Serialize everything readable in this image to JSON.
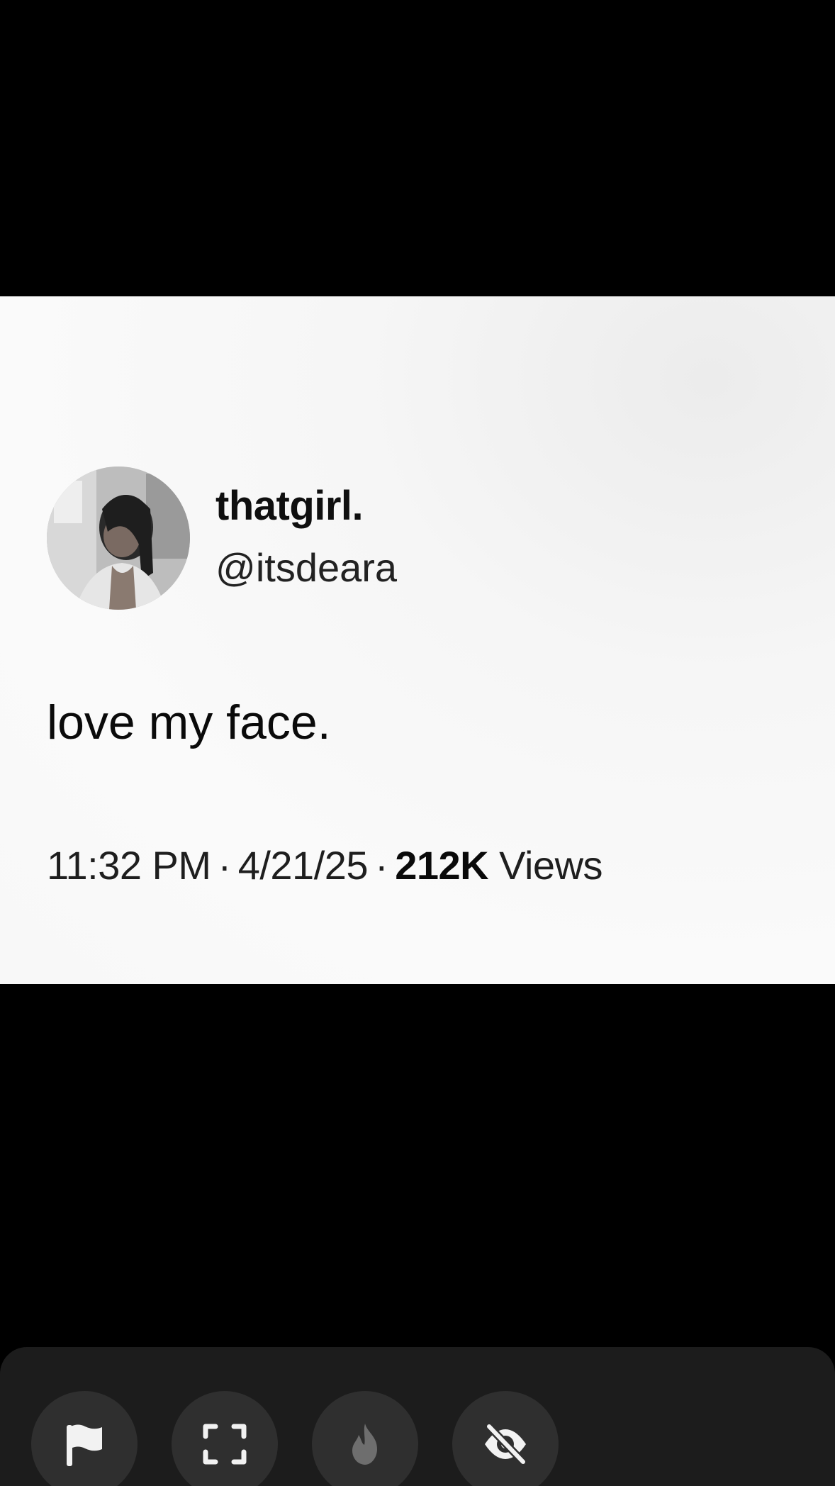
{
  "tweet": {
    "display_name": "thatgirl.",
    "handle": "@itsdeara",
    "text": "love my face.",
    "time": "11:32 PM",
    "date": "4/21/25",
    "separator": "·",
    "views_count": "212K",
    "views_label": "Views"
  },
  "actions": [
    {
      "icon": "flag-icon",
      "color": "#f2f2f2"
    },
    {
      "icon": "fullscreen-icon",
      "color": "#f2f2f2"
    },
    {
      "icon": "fire-icon",
      "color": "#6e6e6e"
    },
    {
      "icon": "eye-off-icon",
      "color": "#f2f2f2"
    }
  ],
  "colors": {
    "background": "#000000",
    "card": "#f8f8f8",
    "panel": "#1c1c1c",
    "button": "#2f2f2f"
  }
}
